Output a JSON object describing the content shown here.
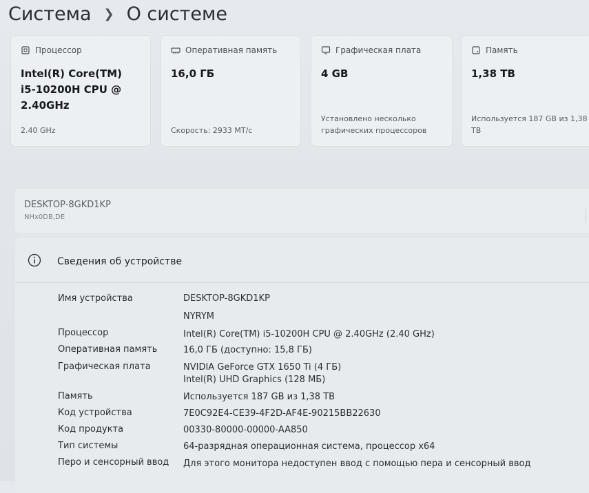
{
  "breadcrumb": {
    "parent": "Система",
    "current": "О системе"
  },
  "cards": {
    "processor": {
      "label": "Процессор",
      "value_line1": "Intel(R) Core(TM)",
      "value_line2": "i5-10200H CPU @",
      "value_line3": "2.40GHz",
      "sub": "2.40 GHz"
    },
    "ram": {
      "label": "Оперативная память",
      "value": "16,0 ГБ",
      "sub": "Скорость: 2933 МТ/с"
    },
    "gpu": {
      "label": "Графическая плата",
      "value": "4 GB",
      "sub_line1": "Установлено несколько",
      "sub_line2": "графических процессоров"
    },
    "storage": {
      "label": "Память",
      "value": "1,38 TB",
      "sub_line1": "Используется 187 GB из 1,38",
      "sub_line2": "TB"
    }
  },
  "device": {
    "name": "DESKTOP-8GKD1KP",
    "model": "NHx0DB,DE",
    "rename_glyph": "П"
  },
  "specs": {
    "title": "Сведения об устройстве",
    "rows": [
      {
        "label": "Имя устройства",
        "value": "DESKTOP-8GKD1KP"
      },
      {
        "label": "",
        "value": "NYRYM"
      },
      {
        "label": "Процессор",
        "value": "Intel(R) Core(TM) i5-10200H CPU @ 2.40GHz (2.40 GHz)"
      },
      {
        "label": "Оперативная память",
        "value": "16,0 ГБ (доступно: 15,8 ГБ)"
      },
      {
        "label": "Графическая плата",
        "value": "NVIDIA GeForce GTX 1650 Ti (4 ГБ)"
      },
      {
        "label": "",
        "value": "Intel(R) UHD Graphics (128 МБ)"
      },
      {
        "label": "Память",
        "value": "Используется 187 GB из 1,38 TB"
      },
      {
        "label": "Код устройства",
        "value": "7E0C92E4-CE39-4F2D-AF4E-90215BB22630"
      },
      {
        "label": "Код продукта",
        "value": "00330-80000-00000-AA850"
      },
      {
        "label": "Тип системы",
        "value": "64-разрядная операционная система, процессор x64"
      },
      {
        "label": "Перо и сенсорный ввод",
        "value": "Для этого монитора недоступен ввод с помощью пера и сенсорный ввод"
      }
    ]
  },
  "colors": {
    "background": "#e3e7eb",
    "card": "#edf0f3",
    "text": "#1f2226",
    "muted": "#55595e"
  },
  "icons": [
    "chevron-right-icon",
    "processor-icon",
    "memory-icon",
    "display-icon",
    "storage-icon",
    "info-icon"
  ]
}
